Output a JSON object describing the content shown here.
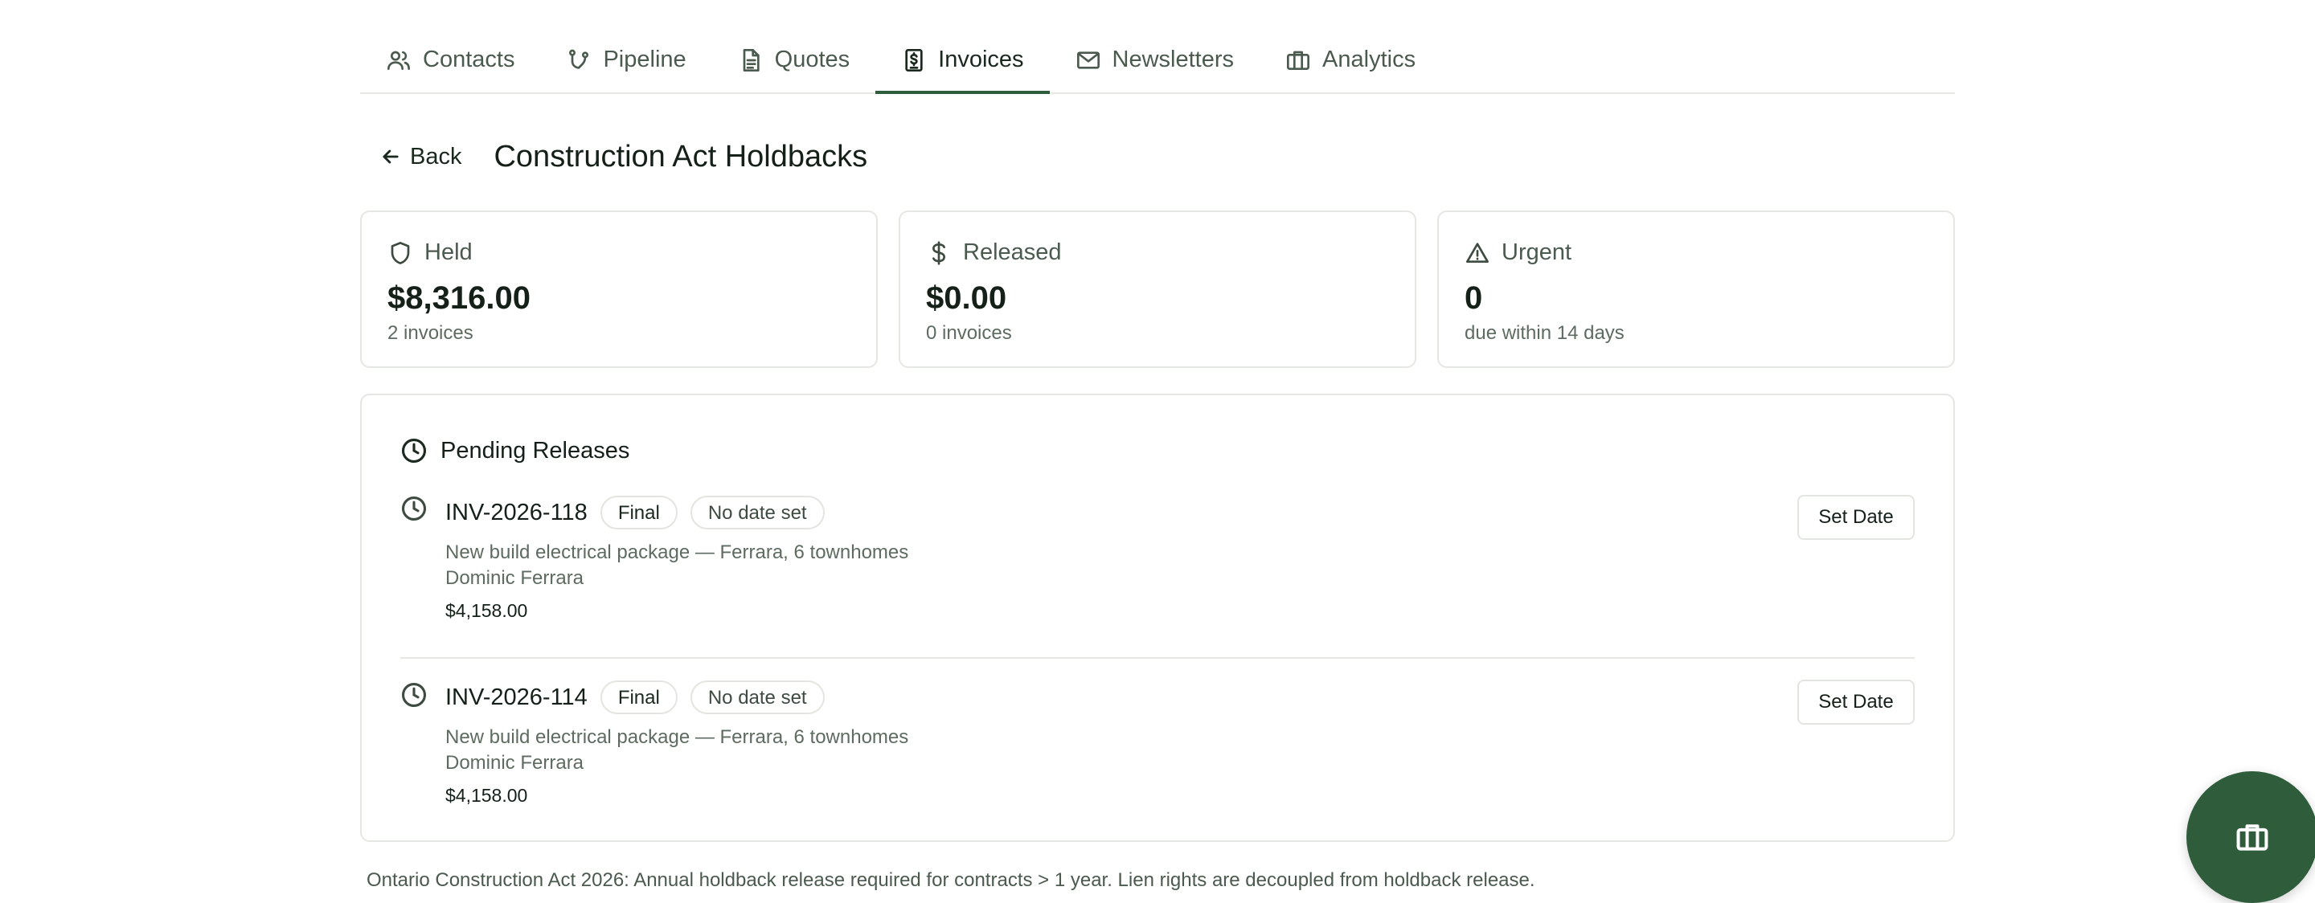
{
  "nav": {
    "tabs": [
      {
        "label": "Contacts",
        "icon": "users-icon"
      },
      {
        "label": "Pipeline",
        "icon": "pipeline-icon"
      },
      {
        "label": "Quotes",
        "icon": "document-icon"
      },
      {
        "label": "Invoices",
        "icon": "invoice-icon",
        "active": true
      },
      {
        "label": "Newsletters",
        "icon": "mail-icon"
      },
      {
        "label": "Analytics",
        "icon": "briefcase-icon"
      }
    ]
  },
  "header": {
    "back_label": "Back",
    "title": "Construction Act Holdbacks"
  },
  "summary": [
    {
      "label": "Held",
      "icon": "shield-icon",
      "value": "$8,316.00",
      "sub": "2 invoices"
    },
    {
      "label": "Released",
      "icon": "dollar-icon",
      "value": "$0.00",
      "sub": "0 invoices"
    },
    {
      "label": "Urgent",
      "icon": "warning-icon",
      "value": "0",
      "sub": "due within 14 days"
    }
  ],
  "pending": {
    "title": "Pending Releases",
    "items": [
      {
        "invoice": "INV-2026-118",
        "type_badge": "Final",
        "date_badge": "No date set",
        "description": "New build electrical package — Ferrara, 6 townhomes",
        "client": "Dominic Ferrara",
        "amount": "$4,158.00",
        "action": "Set Date"
      },
      {
        "invoice": "INV-2026-114",
        "type_badge": "Final",
        "date_badge": "No date set",
        "description": "New build electrical package — Ferrara, 6 townhomes",
        "client": "Dominic Ferrara",
        "amount": "$4,158.00",
        "action": "Set Date"
      }
    ]
  },
  "footnote": "Ontario Construction Act 2026: Annual holdback release required for contracts > 1 year. Lien rights are decoupled from holdback release.",
  "fab": {
    "icon": "briefcase-icon"
  },
  "colors": {
    "accent": "#2f5d3c",
    "border": "#e4e7e2",
    "muted_text": "#5d6b60"
  }
}
